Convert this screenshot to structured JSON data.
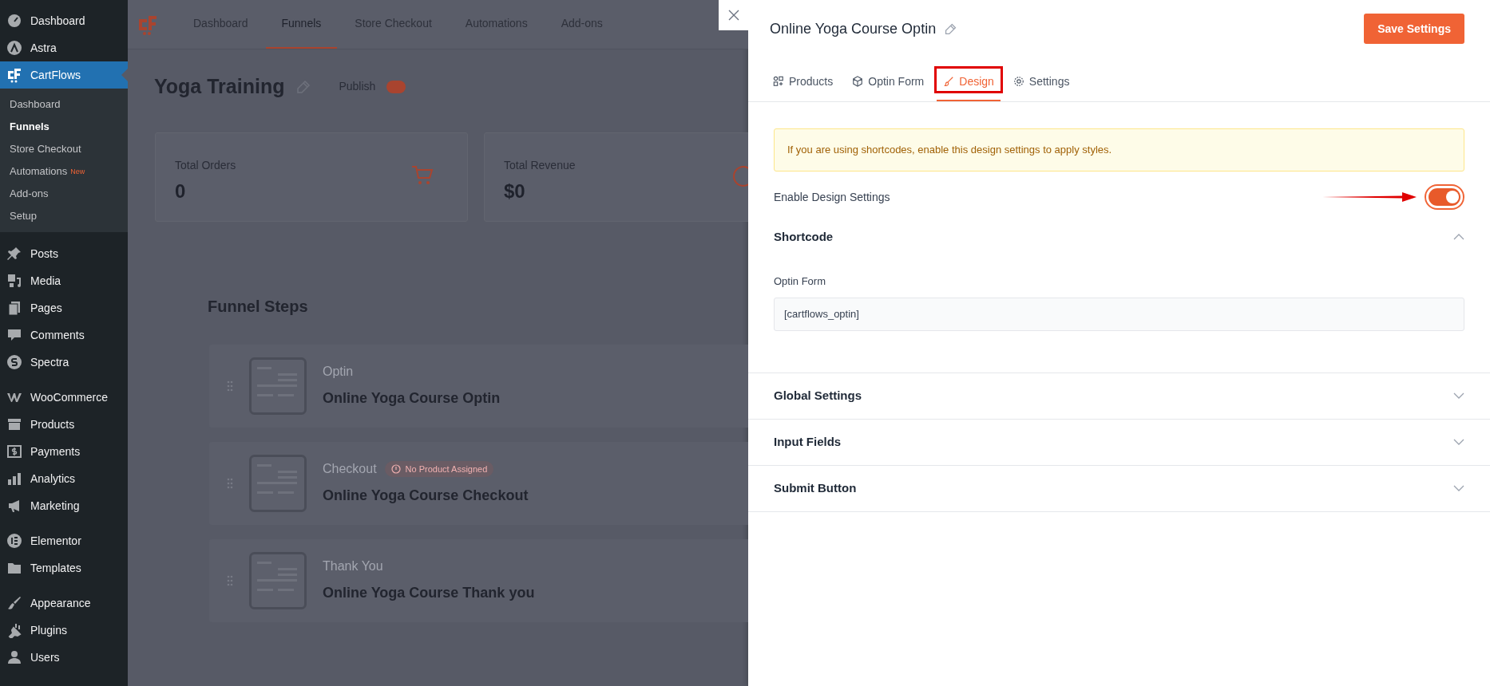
{
  "sidebar": {
    "groups": [
      [
        {
          "label": "Dashboard",
          "selected": false
        },
        {
          "label": "Astra",
          "selected": false
        },
        {
          "label": "CartFlows",
          "selected": true,
          "children": [
            {
              "label": "Dashboard",
              "selected": false
            },
            {
              "label": "Funnels",
              "selected": true
            },
            {
              "label": "Store Checkout",
              "selected": false
            },
            {
              "label": "Automations",
              "badge": "New",
              "selected": false
            },
            {
              "label": "Add-ons",
              "selected": false
            },
            {
              "label": "Setup",
              "selected": false
            }
          ]
        }
      ],
      [
        {
          "label": "Posts",
          "selected": false
        },
        {
          "label": "Media",
          "selected": false
        },
        {
          "label": "Pages",
          "selected": false
        },
        {
          "label": "Comments",
          "selected": false
        },
        {
          "label": "Spectra",
          "selected": false
        }
      ],
      [
        {
          "label": "WooCommerce",
          "selected": false
        },
        {
          "label": "Products",
          "selected": false
        },
        {
          "label": "Payments",
          "selected": false
        },
        {
          "label": "Analytics",
          "selected": false
        },
        {
          "label": "Marketing",
          "selected": false
        }
      ],
      [
        {
          "label": "Elementor",
          "selected": false
        },
        {
          "label": "Templates",
          "selected": false
        }
      ],
      [
        {
          "label": "Appearance",
          "selected": false
        },
        {
          "label": "Plugins",
          "selected": false
        },
        {
          "label": "Users",
          "selected": false
        }
      ]
    ]
  },
  "top_nav": {
    "tabs": [
      {
        "label": "Dashboard",
        "selected": false
      },
      {
        "label": "Funnels",
        "selected": true
      },
      {
        "label": "Store Checkout",
        "selected": false
      },
      {
        "label": "Automations",
        "selected": false
      },
      {
        "label": "Add-ons",
        "selected": false
      }
    ]
  },
  "funnel": {
    "title": "Yoga Training",
    "publish_label": "Publish",
    "published": true
  },
  "stats": [
    {
      "label": "Total Orders",
      "value": "0"
    },
    {
      "label": "Total Revenue",
      "value": "$0"
    }
  ],
  "steps_title": "Funnel Steps",
  "steps": [
    {
      "type": "Optin",
      "name": "Online Yoga Course Optin"
    },
    {
      "type": "Checkout",
      "name": "Online Yoga Course Checkout",
      "badge": "No Product Assigned"
    },
    {
      "type": "Thank You",
      "name": "Online Yoga Course Thank you"
    }
  ],
  "panel": {
    "title": "Online Yoga Course Optin",
    "save_button": "Save Settings",
    "tabs": [
      {
        "label": "Products",
        "selected": false,
        "highlighted": false
      },
      {
        "label": "Optin Form",
        "selected": false,
        "highlighted": false
      },
      {
        "label": "Design",
        "selected": true,
        "highlighted": true
      },
      {
        "label": "Settings",
        "selected": false,
        "highlighted": false
      }
    ],
    "notice": "If you are using shortcodes, enable this design settings to apply styles.",
    "toggle": {
      "label": "Enable Design Settings",
      "on": true,
      "pointer_arrow": true
    },
    "sections": [
      {
        "title": "Shortcode",
        "expanded": true,
        "fields": [
          {
            "label": "Optin Form",
            "value": "[cartflows_optin]"
          }
        ]
      },
      {
        "title": "Global Settings",
        "expanded": false
      },
      {
        "title": "Input Fields",
        "expanded": false
      },
      {
        "title": "Submit Button",
        "expanded": false
      }
    ]
  }
}
